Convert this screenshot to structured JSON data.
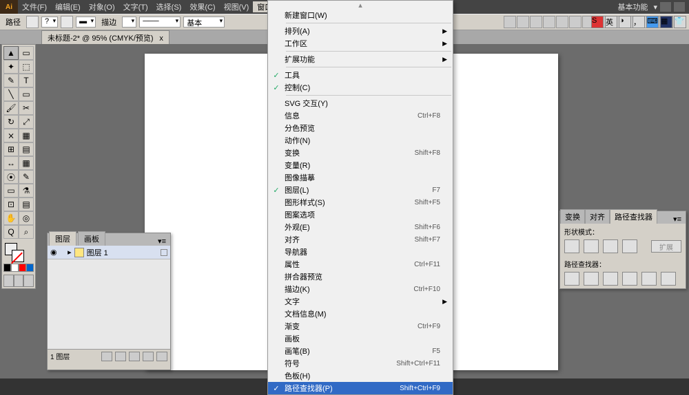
{
  "menubar": {
    "items": [
      {
        "label": "文件(F)"
      },
      {
        "label": "编辑(E)"
      },
      {
        "label": "对象(O)"
      },
      {
        "label": "文字(T)"
      },
      {
        "label": "选择(S)"
      },
      {
        "label": "效果(C)"
      },
      {
        "label": "视图(V)"
      },
      {
        "label": "窗口(W)",
        "active": true
      }
    ],
    "workspace_label": "基本功能"
  },
  "propbar": {
    "pathlabel": "路径",
    "stroke_label": "描边",
    "basic_label": "基本"
  },
  "doctab": {
    "label": "未标题-2* @ 95% (CMYK/预览)",
    "close": "x"
  },
  "dropdown": {
    "groups": [
      [
        {
          "label": "新建窗口(W)"
        }
      ],
      [
        {
          "label": "排列(A)",
          "sub": true
        },
        {
          "label": "工作区",
          "sub": true
        }
      ],
      [
        {
          "label": "扩展功能",
          "sub": true
        }
      ],
      [
        {
          "label": "工具",
          "checked": true
        },
        {
          "label": "控制(C)",
          "checked": true
        }
      ],
      [
        {
          "label": "SVG 交互(Y)"
        },
        {
          "label": "信息",
          "shortcut": "Ctrl+F8"
        },
        {
          "label": "分色预览"
        },
        {
          "label": "动作(N)"
        },
        {
          "label": "变换",
          "shortcut": "Shift+F8"
        },
        {
          "label": "变量(R)"
        },
        {
          "label": "图像描摹"
        },
        {
          "label": "图层(L)",
          "checked": true,
          "shortcut": "F7"
        },
        {
          "label": "图形样式(S)",
          "shortcut": "Shift+F5"
        },
        {
          "label": "图案选项"
        },
        {
          "label": "外观(E)",
          "shortcut": "Shift+F6"
        },
        {
          "label": "对齐",
          "shortcut": "Shift+F7"
        },
        {
          "label": "导航器"
        },
        {
          "label": "属性",
          "shortcut": "Ctrl+F11"
        },
        {
          "label": "拼合器预览"
        },
        {
          "label": "描边(K)",
          "shortcut": "Ctrl+F10"
        },
        {
          "label": "文字",
          "sub": true
        },
        {
          "label": "文档信息(M)"
        },
        {
          "label": "渐变",
          "shortcut": "Ctrl+F9"
        },
        {
          "label": "画板"
        },
        {
          "label": "画笔(B)",
          "shortcut": "F5"
        },
        {
          "label": "符号",
          "shortcut": "Shift+Ctrl+F11"
        },
        {
          "label": "色板(H)"
        },
        {
          "label": "路径查找器(P)",
          "checked": true,
          "highlight": true,
          "shortcut": "Shift+Ctrl+F9"
        }
      ]
    ]
  },
  "layerspanel": {
    "tabs": [
      "图层",
      "画板"
    ],
    "layer_name": "图层 1",
    "status": "1 图层"
  },
  "pathfinder": {
    "tabs": [
      "变换",
      "对齐",
      "路径查找器"
    ],
    "shape_label": "形状模式：",
    "pf_label": "路径查找器：",
    "expand": "扩展"
  },
  "toolglyphs": {
    "r": [
      [
        "▲",
        "▭"
      ],
      [
        "✦",
        "⬚"
      ],
      [
        "✎",
        "T"
      ],
      [
        "╲",
        "▭"
      ],
      [
        "🖌",
        "✂"
      ],
      [
        "↻",
        "⤢"
      ],
      [
        "⨯",
        "▦"
      ],
      [
        "⊞",
        "▤"
      ],
      [
        "↔",
        "▦"
      ],
      [
        "⦿",
        "✎"
      ],
      [
        "▭",
        "⚗"
      ],
      [
        "⊡",
        "▤"
      ],
      [
        "✋",
        "◎"
      ],
      [
        "Q",
        "⌕"
      ]
    ]
  }
}
